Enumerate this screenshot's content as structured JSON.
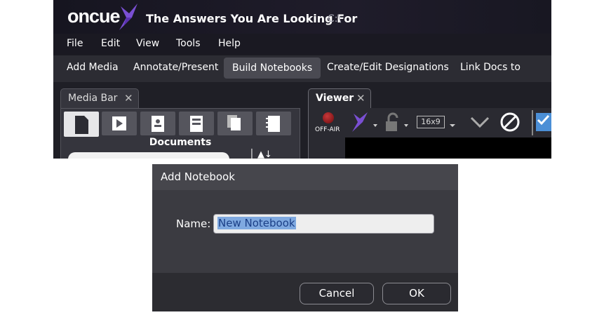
{
  "app": {
    "logo_text": "oncue",
    "title": "The Answers You Are Looking For",
    "path": "C:\\"
  },
  "menu": [
    "File",
    "Edit",
    "View",
    "Tools",
    "Help"
  ],
  "ribbon": {
    "tabs": [
      "Add Media",
      "Annotate/Present",
      "Build Notebooks",
      "Create/Edit Designations",
      "Link Docs to Video"
    ],
    "active_index": 2
  },
  "media_bar": {
    "title": "Media Bar",
    "close_glyph": "✕",
    "icons": [
      "document-icon",
      "play-video-icon",
      "witness-icon",
      "exhibit-icon",
      "multi-document-icon",
      "notebook-icon"
    ],
    "section_label": "Documents"
  },
  "viewer": {
    "title": "Viewer",
    "close_glyph": "✕",
    "off_air_label": "OFF-AIR",
    "aspect_ratio": "16x9"
  },
  "dialog": {
    "title": "Add Notebook",
    "name_label": "Name:",
    "name_value": "New Notebook",
    "cancel_label": "Cancel",
    "ok_label": "OK"
  },
  "colors": {
    "accent_purple": "#6b46c1",
    "selection_highlight": "#7fa9e0",
    "off_air_red": "#c8383a"
  }
}
